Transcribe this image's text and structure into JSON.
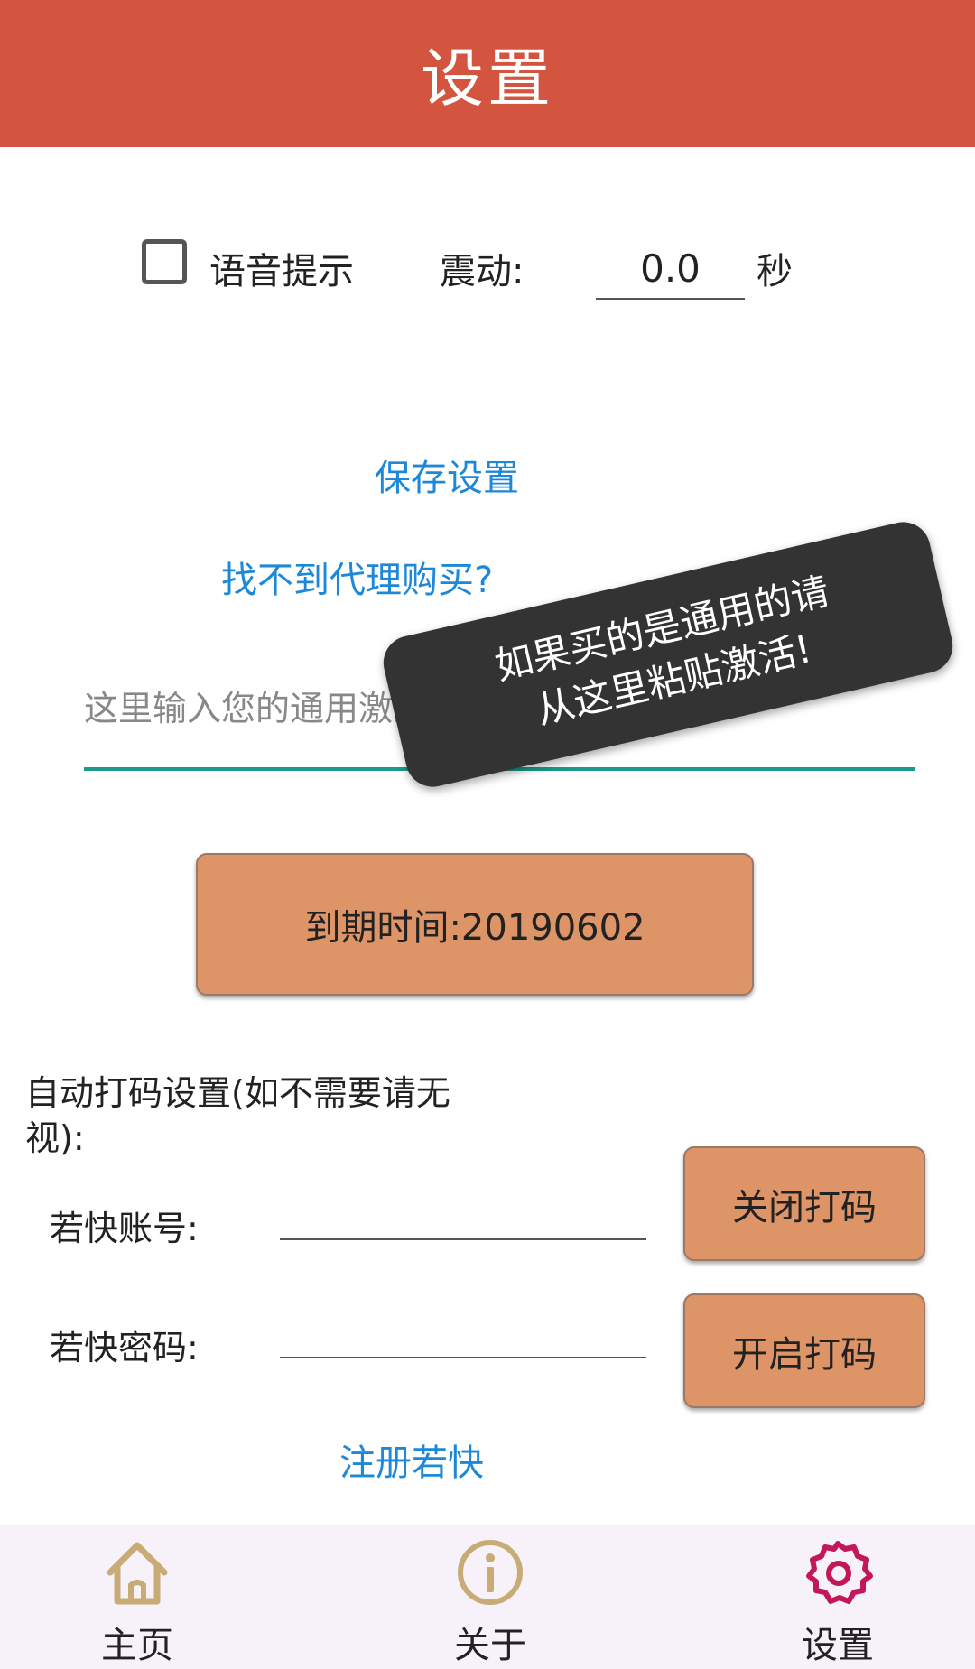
{
  "app_bar": {
    "title": "设置"
  },
  "settings_row": {
    "voice_label": "语音提示",
    "voice_checked": false,
    "vibrate_label": "震动:",
    "vibrate_value": "0.0",
    "vibrate_unit": "秒"
  },
  "links": {
    "save": "保存设置",
    "buy": "找不到代理购买?"
  },
  "activation": {
    "placeholder": "这里输入您的通用激活卡",
    "value": ""
  },
  "toast": {
    "line1": "如果买的是通用的请",
    "line2": "从这里粘贴激活!"
  },
  "expiry_button": {
    "label": "到期时间:20190602"
  },
  "captcha": {
    "heading_line1": "自动打码设置(如不需要请无",
    "heading_line2": "视):",
    "account_label": "若快账号:",
    "account_value": "",
    "password_label": "若快密码:",
    "password_value": "",
    "close_button": "关闭打码",
    "open_button": "开启打码",
    "register_link": "注册若快"
  },
  "bottom_nav": {
    "items": [
      {
        "label": "主页",
        "icon": "home-icon",
        "active": false
      },
      {
        "label": "关于",
        "icon": "info-icon",
        "active": false
      },
      {
        "label": "设置",
        "icon": "gear-icon",
        "active": true
      }
    ],
    "inactive_color": "#c9ab78",
    "active_color": "#c2185b"
  },
  "colors": {
    "app_bar": "#d3553f",
    "button": "#dd9466",
    "link": "#1e88d8",
    "input_focus": "#1a9a8a"
  }
}
